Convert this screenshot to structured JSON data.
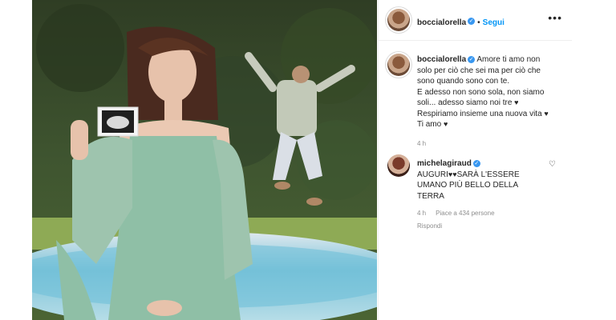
{
  "post": {
    "username": "boccialorella",
    "follow_label": "Segui",
    "more_label": "•••",
    "caption": {
      "username": "boccialorella",
      "lines": [
        "Amore ti amo non",
        "solo per ciò che sei ma per ciò che",
        "sono quando sono con te.",
        "E adesso non sono sola, non siamo",
        "soli... adesso siamo noi tre",
        "Respiriamo insieme una nuova vita",
        "Ti amo"
      ],
      "time": "4 h"
    },
    "comment": {
      "username": "michelagiraud",
      "lines": [
        "AUGURI",
        "SARÀ L'ESSERE",
        "UMANO PIÙ BELLO DELLA",
        "TERRA"
      ],
      "time": "4 h",
      "likes": "Piace a 434 persone",
      "reply_label": "Rispondi"
    }
  }
}
